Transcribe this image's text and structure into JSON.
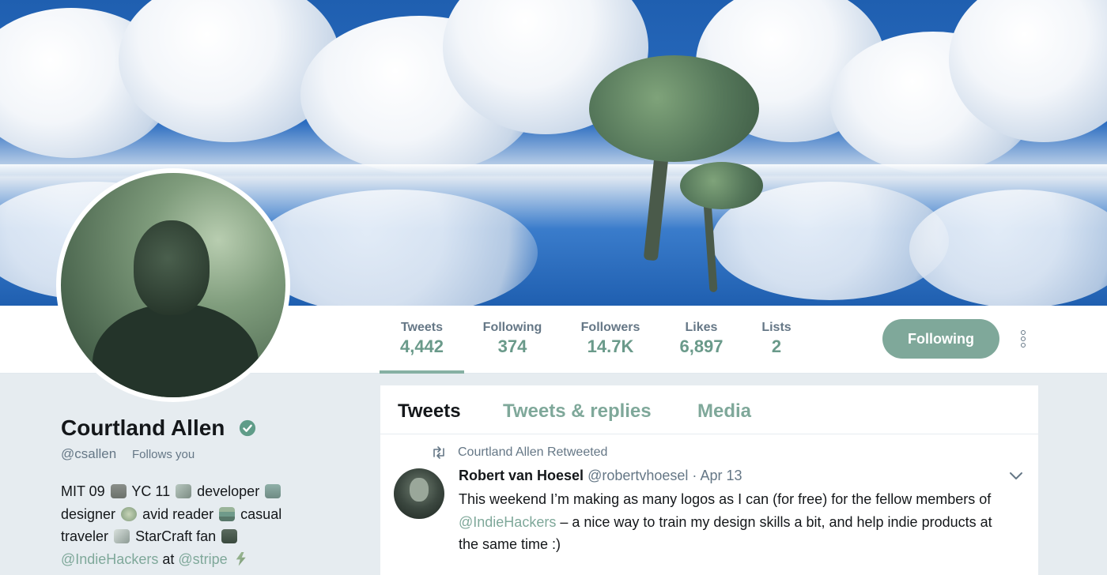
{
  "profile": {
    "name": "Courtland Allen",
    "handle": "@csallen",
    "follows_you": "Follows you",
    "bio": {
      "line1_a": "MIT 09",
      "line1_b": "YC 11",
      "line1_c": "developer",
      "line2_a": "designer",
      "line2_b": "avid reader",
      "line2_c": "casual",
      "line3_a": "traveler",
      "line3_b": "StarCraft fan",
      "mention1": "@IndieHackers",
      "at": "at",
      "mention2": "@stripe"
    }
  },
  "stats": [
    {
      "label": "Tweets",
      "value": "4,442"
    },
    {
      "label": "Following",
      "value": "374"
    },
    {
      "label": "Followers",
      "value": "14.7K"
    },
    {
      "label": "Likes",
      "value": "6,897"
    },
    {
      "label": "Lists",
      "value": "2"
    }
  ],
  "follow_button": "Following",
  "tabs": [
    "Tweets",
    "Tweets & replies",
    "Media"
  ],
  "tweet": {
    "retweet_label": "Courtland Allen Retweeted",
    "author": "Robert van Hoesel",
    "author_handle": "@robertvhoesel",
    "separator": "·",
    "date": "Apr 13",
    "text_a": "This weekend I’m making as many logos as I can (for free) for the fellow members of ",
    "mention": "@IndieHackers",
    "text_b": " – a nice way to train my design skills a bit, and help indie products at the same time :)"
  },
  "icons": {
    "verified": "verified-badge-icon",
    "more": "more-options-icon",
    "retweet": "retweet-icon",
    "caret": "chevron-down-icon"
  },
  "colors": {
    "accent": "#7fa89a",
    "text": "#14171a",
    "muted": "#657786",
    "background": "#e6ecf0"
  }
}
